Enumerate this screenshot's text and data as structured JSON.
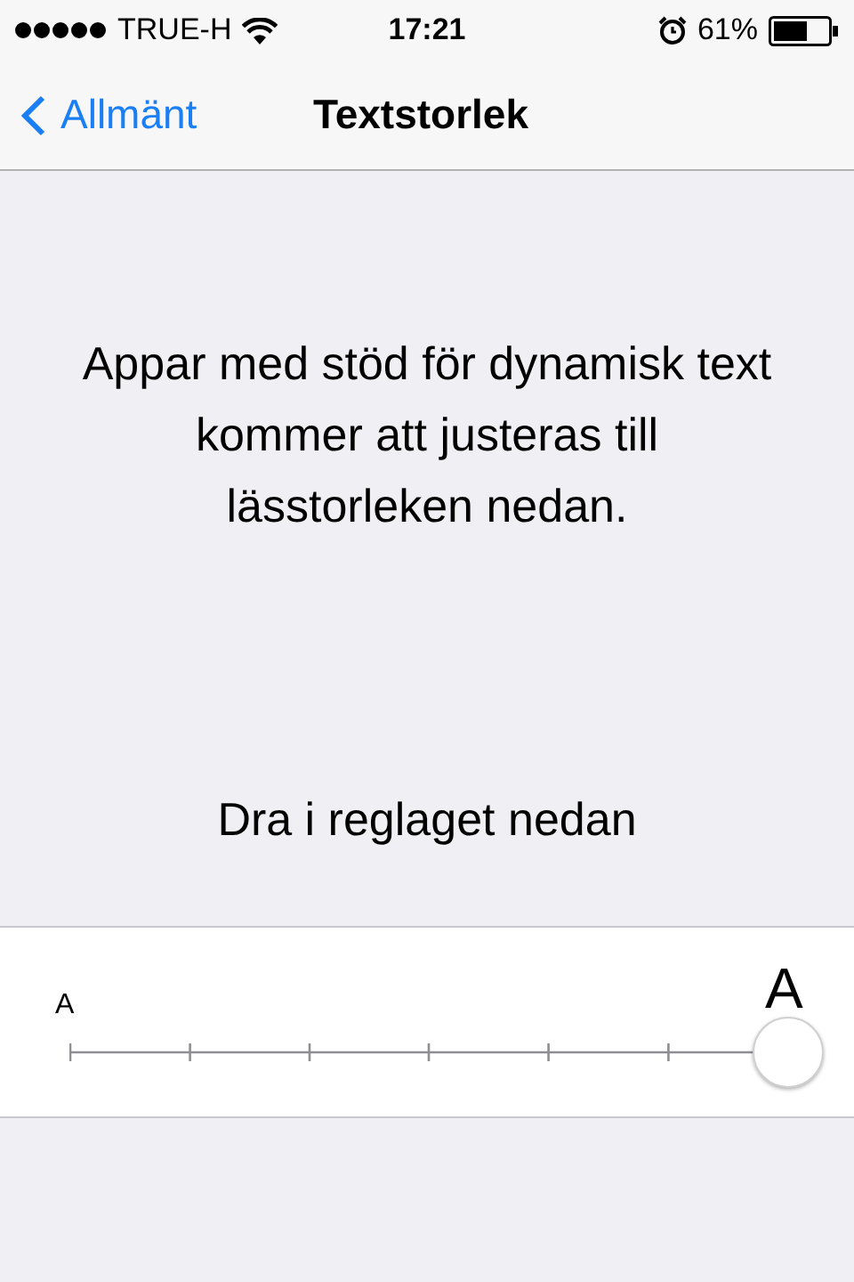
{
  "status_bar": {
    "carrier": "TRUE-H",
    "time": "17:21",
    "battery_percent": "61%"
  },
  "nav_bar": {
    "back_label": "Allmänt",
    "title": "Textstorlek"
  },
  "description": "Appar med stöd för dynamisk text kommer att justeras till lässtorleken nedan.",
  "instruction": "Dra i reglaget nedan",
  "slider": {
    "small_label": "A",
    "large_label": "A",
    "level": 1
  }
}
